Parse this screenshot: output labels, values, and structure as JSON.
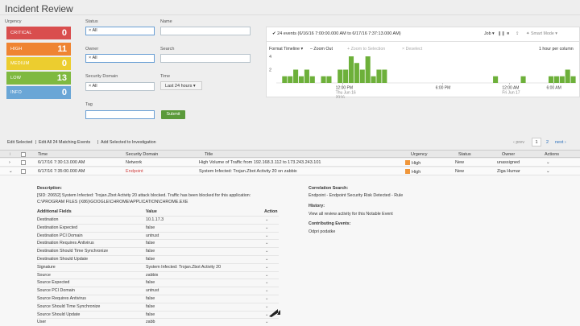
{
  "page": {
    "title": "Incident Review"
  },
  "urgency": {
    "label": "Urgency",
    "tiles": [
      {
        "name": "CRITICAL",
        "count": "0",
        "color": "#d94e4e"
      },
      {
        "name": "HIGH",
        "count": "11",
        "color": "#ef8432"
      },
      {
        "name": "MEDIUM",
        "count": "0",
        "color": "#eccd2f"
      },
      {
        "name": "LOW",
        "count": "13",
        "color": "#7fb940"
      },
      {
        "name": "INFO",
        "count": "0",
        "color": "#6aa6d6"
      }
    ]
  },
  "filters": {
    "status_label": "Status",
    "status_value": "All",
    "name_label": "Name",
    "owner_label": "Owner",
    "owner_value": "All",
    "search_label": "Search",
    "domain_label": "Security Domain",
    "domain_value": "All",
    "time_label": "Time",
    "time_value": "Last 24 hours",
    "tag_label": "Tag",
    "submit_label": "Submit"
  },
  "timeline": {
    "events_summary": "24 events (6/16/16 7:00:00.000 AM to 6/17/16 7:37:13.000 AM)",
    "job_label": "Job",
    "mode_label": "Smart Mode",
    "format_label": "Format Timeline",
    "zoom_out_label": "– Zoom Out",
    "zoom_selection_label": "+ Zoom to Selection",
    "deselect_label": "× Deselect",
    "scale_label": "1 hour per column",
    "y_ticks": [
      "4",
      "2"
    ],
    "x_ticks": [
      {
        "l1": "12:00 PM",
        "l2": "Thu Jun 16",
        "l3": "2016"
      },
      {
        "l1": "6:00 PM",
        "l2": "",
        "l3": ""
      },
      {
        "l1": "12:00 AM",
        "l2": "Fri Jun 17",
        "l3": ""
      },
      {
        "l1": "6:00 AM",
        "l2": "",
        "l3": ""
      }
    ],
    "bars": [
      0,
      1,
      1,
      2,
      1,
      2,
      1,
      0,
      1,
      1,
      0,
      2,
      2,
      4,
      3,
      2,
      4,
      1,
      2,
      2,
      0,
      0,
      0,
      0,
      0,
      0,
      0,
      0,
      0,
      0,
      0,
      0,
      0,
      0,
      0,
      0,
      0,
      0,
      0,
      1,
      0,
      0,
      0,
      0,
      1,
      0,
      0,
      0,
      0,
      1,
      1,
      1,
      2,
      1
    ]
  },
  "actions_bar": {
    "edit_selected": "Edit Selected",
    "sep": "|",
    "edit_all": "Edit All 24 Matching Events",
    "add_investigation": "Add Selected to Investigation",
    "prev": "‹ prev",
    "page1": "1",
    "page2": "2",
    "next": "next ›"
  },
  "table": {
    "headers": {
      "info": "i",
      "time": "Time",
      "domain": "Security Domain",
      "title": "Title",
      "urgency": "Urgency",
      "status": "Status",
      "owner": "Owner",
      "actions": "Actions"
    },
    "rows": [
      {
        "expander": "›",
        "time": "6/17/16 7:30:13.000 AM",
        "domain": "Network",
        "title": "High Volume of Traffic from 192.168.3.112 to 173.243.243.101",
        "urgency": "High",
        "status": "New",
        "owner": "unassigned",
        "action": "⌄"
      },
      {
        "expander": "⌄",
        "time": "6/17/16 7:35:00.000 AM",
        "domain": "Endpoint",
        "title": "System Infected: Trojan.Zbot Activity 20 on zabbix",
        "urgency": "High",
        "status": "New",
        "owner": "Ziga Humar",
        "action": "⌄"
      }
    ]
  },
  "details": {
    "description_label": "Description:",
    "description_line1": "[SID: 20652] System Infected: Trojan.Zbot Activity 20 attack blocked. Traffic has been blocked for this application:",
    "description_line2": "C:\\PROGRAM FILES (X86)\\GOOGLE\\CHROME\\APPLICATION\\CHROME.EXE",
    "fields_header": "Additional Fields",
    "value_header": "Value",
    "action_header": "Action",
    "fields": [
      {
        "name": "Destination",
        "value": "10.1.17.3"
      },
      {
        "name": "Destination Expected",
        "value": "false"
      },
      {
        "name": "Destination PCI Domain",
        "value": "untrust"
      },
      {
        "name": "Destination Requires Antivirus",
        "value": "false"
      },
      {
        "name": "Destination Should Time Synchronize",
        "value": "false"
      },
      {
        "name": "Destination Should Update",
        "value": "false"
      },
      {
        "name": "Signature",
        "value": "System Infected: Trojan.Zbot Activity 20"
      },
      {
        "name": "Source",
        "value": "zabbix"
      },
      {
        "name": "Source Expected",
        "value": "false"
      },
      {
        "name": "Source PCI Domain",
        "value": "untrust"
      },
      {
        "name": "Source Requires Antivirus",
        "value": "false"
      },
      {
        "name": "Source Should Time Synchronize",
        "value": "false"
      },
      {
        "name": "Source Should Update",
        "value": "false"
      },
      {
        "name": "User",
        "value": "zabb"
      }
    ],
    "action_glyph": "⌄",
    "correlation_label": "Correlation Search:",
    "correlation_value": "Endpoint - Endpoint Security Risk Detected - Rule",
    "history_label": "History:",
    "history_value": "View all review activity for this Notable Event",
    "contributing_label": "Contributing Events:",
    "contributing_value": "Odpri podatke"
  }
}
